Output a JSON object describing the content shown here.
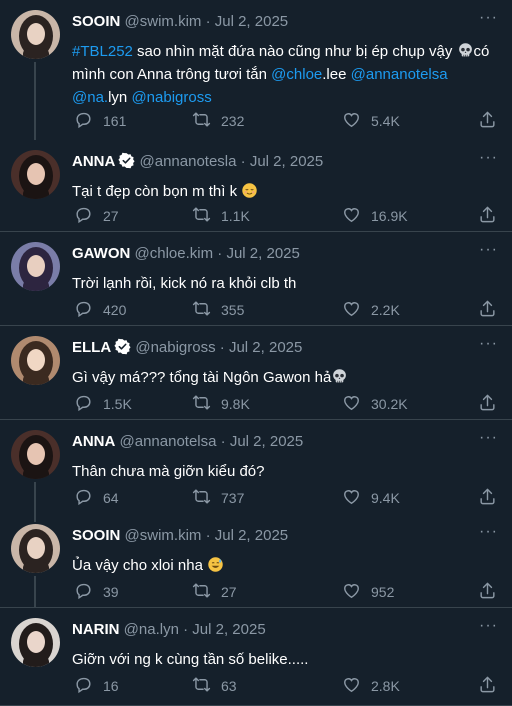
{
  "tweets": [
    {
      "name": "SOOIN",
      "handle": "@swim.kim",
      "date": "Jul 2, 2025",
      "verified": false,
      "text_parts": [
        {
          "t": "#TBL252",
          "link": true
        },
        {
          "t": " sao nhìn mặt đứa nào cũng như bị ép chụp vậy ",
          "link": false
        },
        {
          "emoji": "skull"
        },
        {
          "t": "có mình con Anna trông tươi tắn ",
          "link": false
        },
        {
          "t": "@chloe",
          "link": true
        },
        {
          "t": ".lee ",
          "link": false
        },
        {
          "t": "@annanotelsa",
          "link": true
        },
        {
          "t": " ",
          "link": false
        },
        {
          "t": "@na.",
          "link": true
        },
        {
          "t": "lyn ",
          "link": false
        },
        {
          "t": "@nabigross",
          "link": true
        }
      ],
      "replies": "161",
      "retweets": "232",
      "likes": "5.4K"
    },
    {
      "name": "ANNA",
      "handle": "@annanotesla",
      "date": "Jul 2, 2025",
      "verified": true,
      "text_parts": [
        {
          "t": "Tại t đẹp còn bọn m thì k ",
          "link": false
        },
        {
          "emoji": "relieved"
        }
      ],
      "replies": "27",
      "retweets": "1.1K",
      "likes": "16.9K"
    },
    {
      "name": "GAWON",
      "handle": "@chloe.kim",
      "date": "Jul 2, 2025",
      "verified": false,
      "text_parts": [
        {
          "t": "Trời lạnh rồi, kick nó ra khỏi clb th",
          "link": false
        }
      ],
      "replies": "420",
      "retweets": "355",
      "likes": "2.2K"
    },
    {
      "name": "ELLA",
      "handle": "@nabigross",
      "date": "Jul 2, 2025",
      "verified": true,
      "text_parts": [
        {
          "t": "Gì vậy má??? tổng tài Ngôn Gawon hả",
          "link": false
        },
        {
          "emoji": "skull"
        }
      ],
      "replies": "1.5K",
      "retweets": "9.8K",
      "likes": "30.2K"
    },
    {
      "name": "ANNA",
      "handle": "@annanotelsa",
      "date": "Jul 2, 2025",
      "verified": false,
      "text_parts": [
        {
          "t": "Thân chưa mà giỡn kiểu đó?",
          "link": false
        }
      ],
      "replies": "64",
      "retweets": "737",
      "likes": "9.4K"
    },
    {
      "name": "SOOIN",
      "handle": "@swim.kim",
      "date": "Jul 2, 2025",
      "verified": false,
      "text_parts": [
        {
          "t": "Ủa vậy cho xloi nha ",
          "link": false
        },
        {
          "emoji": "sweat-smile"
        }
      ],
      "replies": "39",
      "retweets": "27",
      "likes": "952"
    },
    {
      "name": "NARIN",
      "handle": "@na.lyn",
      "date": "Jul 2, 2025",
      "verified": false,
      "text_parts": [
        {
          "t": "Giỡn với ng k cùng tần số belike.....",
          "link": false
        }
      ],
      "replies": "16",
      "retweets": "63",
      "likes": "2.8K"
    }
  ],
  "dot": "·",
  "more_glyph": "···",
  "colors": {
    "background": "#15202b",
    "text": "#ffffff",
    "secondary": "#8b98a5",
    "link": "#1d9bf0",
    "divider": "#38444d"
  },
  "icons": [
    "reply-icon",
    "retweet-icon",
    "like-icon",
    "share-icon",
    "more-icon",
    "verified-badge-icon"
  ]
}
